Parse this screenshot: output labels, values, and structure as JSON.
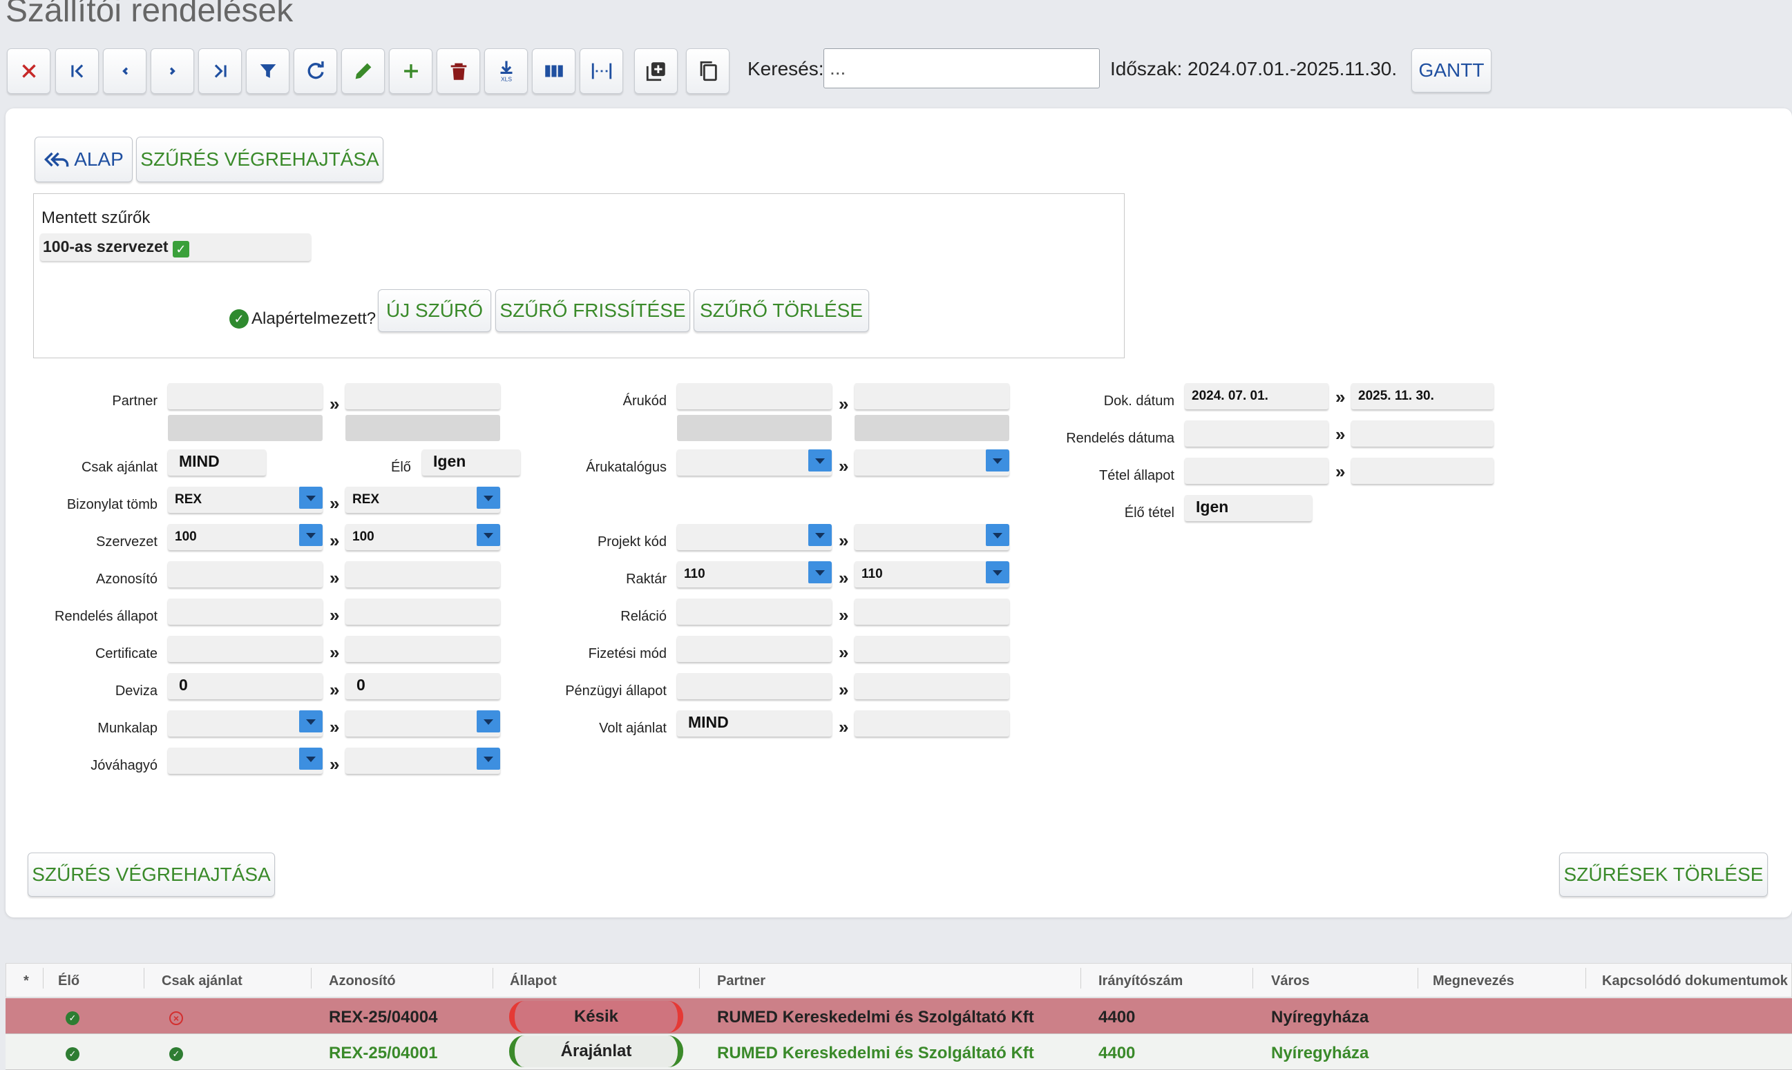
{
  "page": {
    "title": "Szállítói rendelések"
  },
  "toolbar": {
    "buttons": [
      {
        "icon": "close-icon"
      },
      {
        "icon": "first-icon"
      },
      {
        "icon": "prev-icon"
      },
      {
        "icon": "next-icon"
      },
      {
        "icon": "last-icon"
      },
      {
        "icon": "filter-icon"
      },
      {
        "icon": "refresh-icon"
      },
      {
        "icon": "edit-icon"
      },
      {
        "icon": "add-icon"
      },
      {
        "icon": "delete-icon"
      },
      {
        "icon": "xls-download-icon",
        "text": "XLS"
      },
      {
        "icon": "columns-icon"
      },
      {
        "icon": "column-width-icon"
      },
      {
        "icon": "add-copy-icon"
      },
      {
        "icon": "copy-icon"
      }
    ],
    "search_label": "Keresés:",
    "search_value": "...",
    "period": "Időszak: 2024.07.01.-2025.11.30.",
    "gantt": "GANTT"
  },
  "filter": {
    "alap": "ALAP",
    "run_top": "SZŰRÉS VÉGREHAJTÁSA",
    "saved_title": "Mentett szűrők",
    "saved_item": "100-as szervezet",
    "default_q": "Alapértelmezett?",
    "new_filter": "ÚJ SZŰRŐ",
    "refresh_filter": "SZŰRŐ FRISSÍTÉSE",
    "delete_filter": "SZŰRŐ TÖRLÉSE",
    "run_bottom": "SZŰRÉS VÉGREHAJTÁSA",
    "clear_filters": "SZŰRÉSEK TÖRLÉSE",
    "range_sep": "»",
    "labels": {
      "partner": "Partner",
      "csak_ajanlat": "Csak ajánlat",
      "elo": "Élő",
      "bizonylat_tomb": "Bizonylat tömb",
      "szervezet": "Szervezet",
      "azonosito": "Azonosító",
      "rendeles_allapot": "Rendelés állapot",
      "certificate": "Certificate",
      "deviza": "Deviza",
      "munkalap": "Munkalap",
      "jovahagyo": "Jóváhagyó",
      "arukod": "Árukód",
      "arukatalogus": "Árukatalógus",
      "projekt_kod": "Projekt kód",
      "raktar": "Raktár",
      "relacio": "Reláció",
      "fizetesi_mod": "Fizetési mód",
      "penzugyi_allapot": "Pénzügyi állapot",
      "volt_ajanlat": "Volt ajánlat",
      "dok_datum": "Dok. dátum",
      "rendeles_datuma": "Rendelés dátuma",
      "tetel_allapot": "Tétel állapot",
      "elo_tetel": "Élő tétel"
    },
    "values": {
      "csak_ajanlat": "MIND",
      "elo": "Igen",
      "bizonylat_from": "REX",
      "bizonylat_to": "REX",
      "szervezet_from": "100",
      "szervezet_to": "100",
      "deviza_from": "0",
      "deviza_to": "0",
      "raktar_from": "110",
      "raktar_to": "110",
      "volt_ajanlat": "MIND",
      "dok_from": "2024. 07. 01.",
      "dok_to": "2025. 11. 30.",
      "elo_tetel": "Igen"
    }
  },
  "grid": {
    "columns": [
      "*",
      "Élő",
      "Csak ajánlat",
      "Azonosító",
      "Állapot",
      "Partner",
      "Irányítószám",
      "Város",
      "Megnevezés",
      "Kapcsolódó dokumentumok"
    ],
    "rows": [
      {
        "elo": "ok",
        "csak_ajanlat": "x",
        "azonosito": "REX-25/04004",
        "allapot": "Késik",
        "partner": "RUMED Kereskedelmi és Szolgáltató Kft",
        "irsz": "4400",
        "varos": "Nyíregyháza",
        "color": "#cc8088"
      },
      {
        "elo": "ok",
        "csak_ajanlat": "ok",
        "azonosito": "REX-25/04001",
        "allapot": "Árajánlat",
        "partner": "RUMED Kereskedelmi és Szolgáltató Kft",
        "irsz": "4400",
        "varos": "Nyíregyháza",
        "color": "#f1f3f1"
      }
    ]
  }
}
